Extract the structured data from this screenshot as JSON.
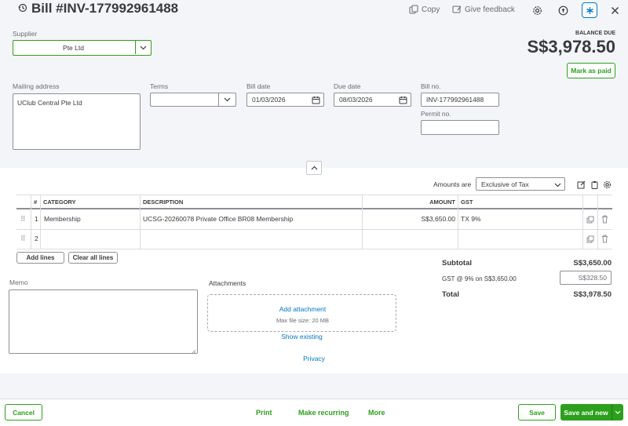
{
  "header": {
    "title": "Bill #INV-177992961488",
    "copy_label": "Copy",
    "feedback_label": "Give feedback"
  },
  "supplier": {
    "label": "Supplier",
    "value": "Pte Ltd"
  },
  "balance": {
    "label": "BALANCE DUE",
    "amount": "S$3,978.50",
    "mark_paid_label": "Mark as paid"
  },
  "mailing": {
    "label": "Mailing address",
    "value": "UClub Central Pte Ltd"
  },
  "terms": {
    "label": "Terms",
    "value": ""
  },
  "bill_date": {
    "label": "Bill date",
    "value": "01/03/2026"
  },
  "due_date": {
    "label": "Due date",
    "value": "08/03/2026"
  },
  "bill_no": {
    "label": "Bill no.",
    "value": "INV-177992961488"
  },
  "permit_no": {
    "label": "Permit no.",
    "value": ""
  },
  "amounts_are": {
    "label": "Amounts are",
    "value": "Exclusive of Tax"
  },
  "table": {
    "columns": {
      "num": "#",
      "category": "CATEGORY",
      "description": "DESCRIPTION",
      "amount": "AMOUNT",
      "gst": "GST"
    },
    "rows": [
      {
        "num": "1",
        "category": "Membership",
        "description": "UCSG-20260078 Private Office BR08 Membership",
        "amount": "S$3,650.00",
        "gst": "TX 9%"
      },
      {
        "num": "2",
        "category": "",
        "description": "",
        "amount": "",
        "gst": ""
      }
    ],
    "add_lines_label": "Add lines",
    "clear_lines_label": "Clear all lines"
  },
  "totals": {
    "subtotal_label": "Subtotal",
    "subtotal_value": "S$3,650.00",
    "gst_label": "GST @ 9% on S$3,650.00",
    "gst_value": "S$328.50",
    "total_label": "Total",
    "total_value": "S$3,978.50"
  },
  "memo": {
    "label": "Memo",
    "value": ""
  },
  "attachments": {
    "label": "Attachments",
    "add_label": "Add attachment",
    "max_size": "Max file size: 20 MB",
    "show_existing": "Show existing"
  },
  "privacy_label": "Privacy",
  "footer": {
    "cancel": "Cancel",
    "print": "Print",
    "make_recurring": "Make recurring",
    "more": "More",
    "save": "Save",
    "save_new": "Save and new"
  },
  "colors": {
    "brand_green": "#2ca01c",
    "link_blue": "#0077c5",
    "text": "#393a3d"
  }
}
